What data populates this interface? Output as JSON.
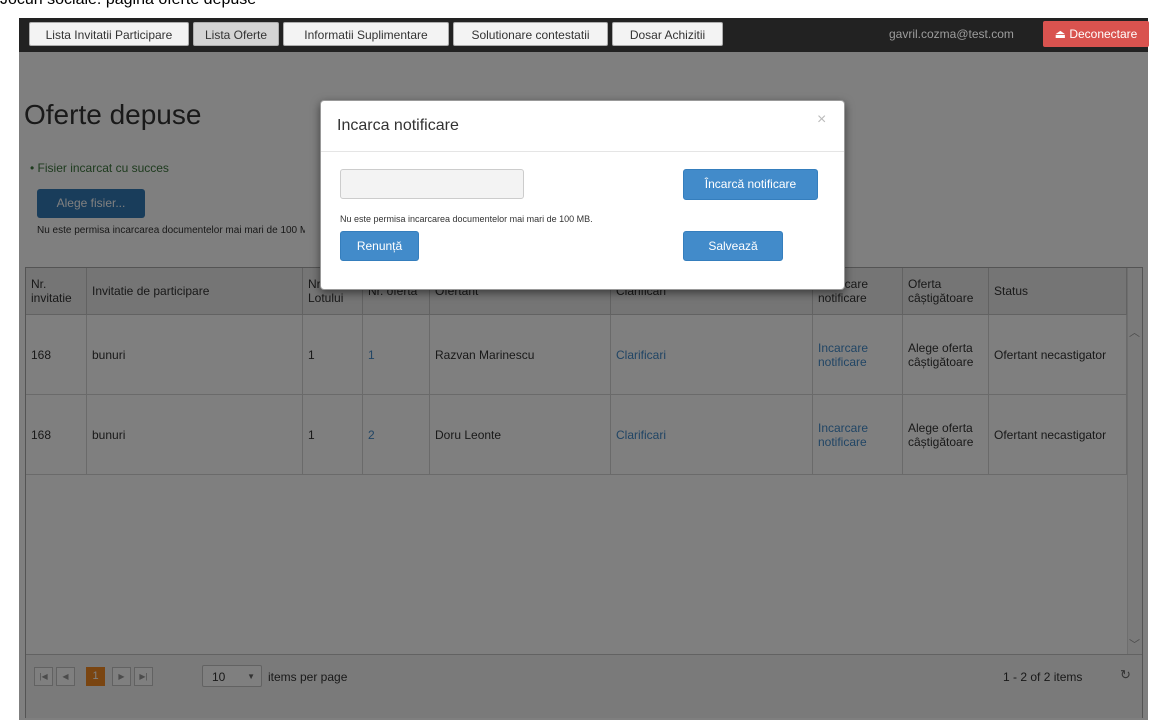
{
  "caption": "Jocuri sociale: pagina oferte depuse",
  "navbar": {
    "items": [
      {
        "label": "Lista Invitatii Participare",
        "active": false
      },
      {
        "label": "Lista Oferte",
        "active": true
      },
      {
        "label": "Informatii Suplimentare",
        "active": false
      },
      {
        "label": "Solutionare contestatii",
        "active": false
      },
      {
        "label": "Dosar Achizitii",
        "active": false
      }
    ],
    "user_email": "gavril.cozma@test.com",
    "logout_label": "Deconectare",
    "logout_icon": "sign-out-icon"
  },
  "page": {
    "title": "Oferte depuse",
    "success_message": "Fisier incarcat cu succes",
    "choose_file_label": "Alege fisier...",
    "size_note": "Nu este permisa incarcarea documentelor mai mari de 100 MB."
  },
  "table": {
    "columns": [
      "Nr. invitatie",
      "Invitatie de participare",
      "Nr. Lotului",
      "Nr. oferta",
      "Ofertant",
      "Clarificari",
      "Incarcare notificare",
      "Oferta câștigătoare",
      "Status"
    ],
    "rows": [
      {
        "nr_invitatie": "168",
        "invitatie": "bunuri",
        "lot": "1",
        "oferta": "1",
        "ofertant": "Razvan Marinescu",
        "clarificari": "Clarificari",
        "incarcare": "Incarcare notificare",
        "castigatoare": "Alege oferta câștigătoare",
        "status": "Ofertant necastigator"
      },
      {
        "nr_invitatie": "168",
        "invitatie": "bunuri",
        "lot": "1",
        "oferta": "2",
        "ofertant": "Doru Leonte",
        "clarificari": "Clarificari",
        "incarcare": "Incarcare notificare",
        "castigatoare": "Alege oferta câștigătoare",
        "status": "Ofertant necastigator"
      }
    ]
  },
  "pager": {
    "first": "|◀",
    "prev": "◀",
    "current_page": "1",
    "next": "▶",
    "last": "▶|",
    "page_size": "10",
    "items_per_page_label": "items per page",
    "info": "1 - 2 of 2 items"
  },
  "modal": {
    "title": "Incarca notificare",
    "close": "×",
    "upload_label": "Încarcă notificare",
    "note": "Nu este permisa incarcarea documentelor mai mari de 100 MB.",
    "cancel_label": "Renunță",
    "save_label": "Salvează"
  },
  "colors": {
    "navbar": "#222222",
    "primary": "#428bca",
    "danger": "#d9534f",
    "success_text": "#3c763d",
    "pager_current": "#f58a23"
  }
}
